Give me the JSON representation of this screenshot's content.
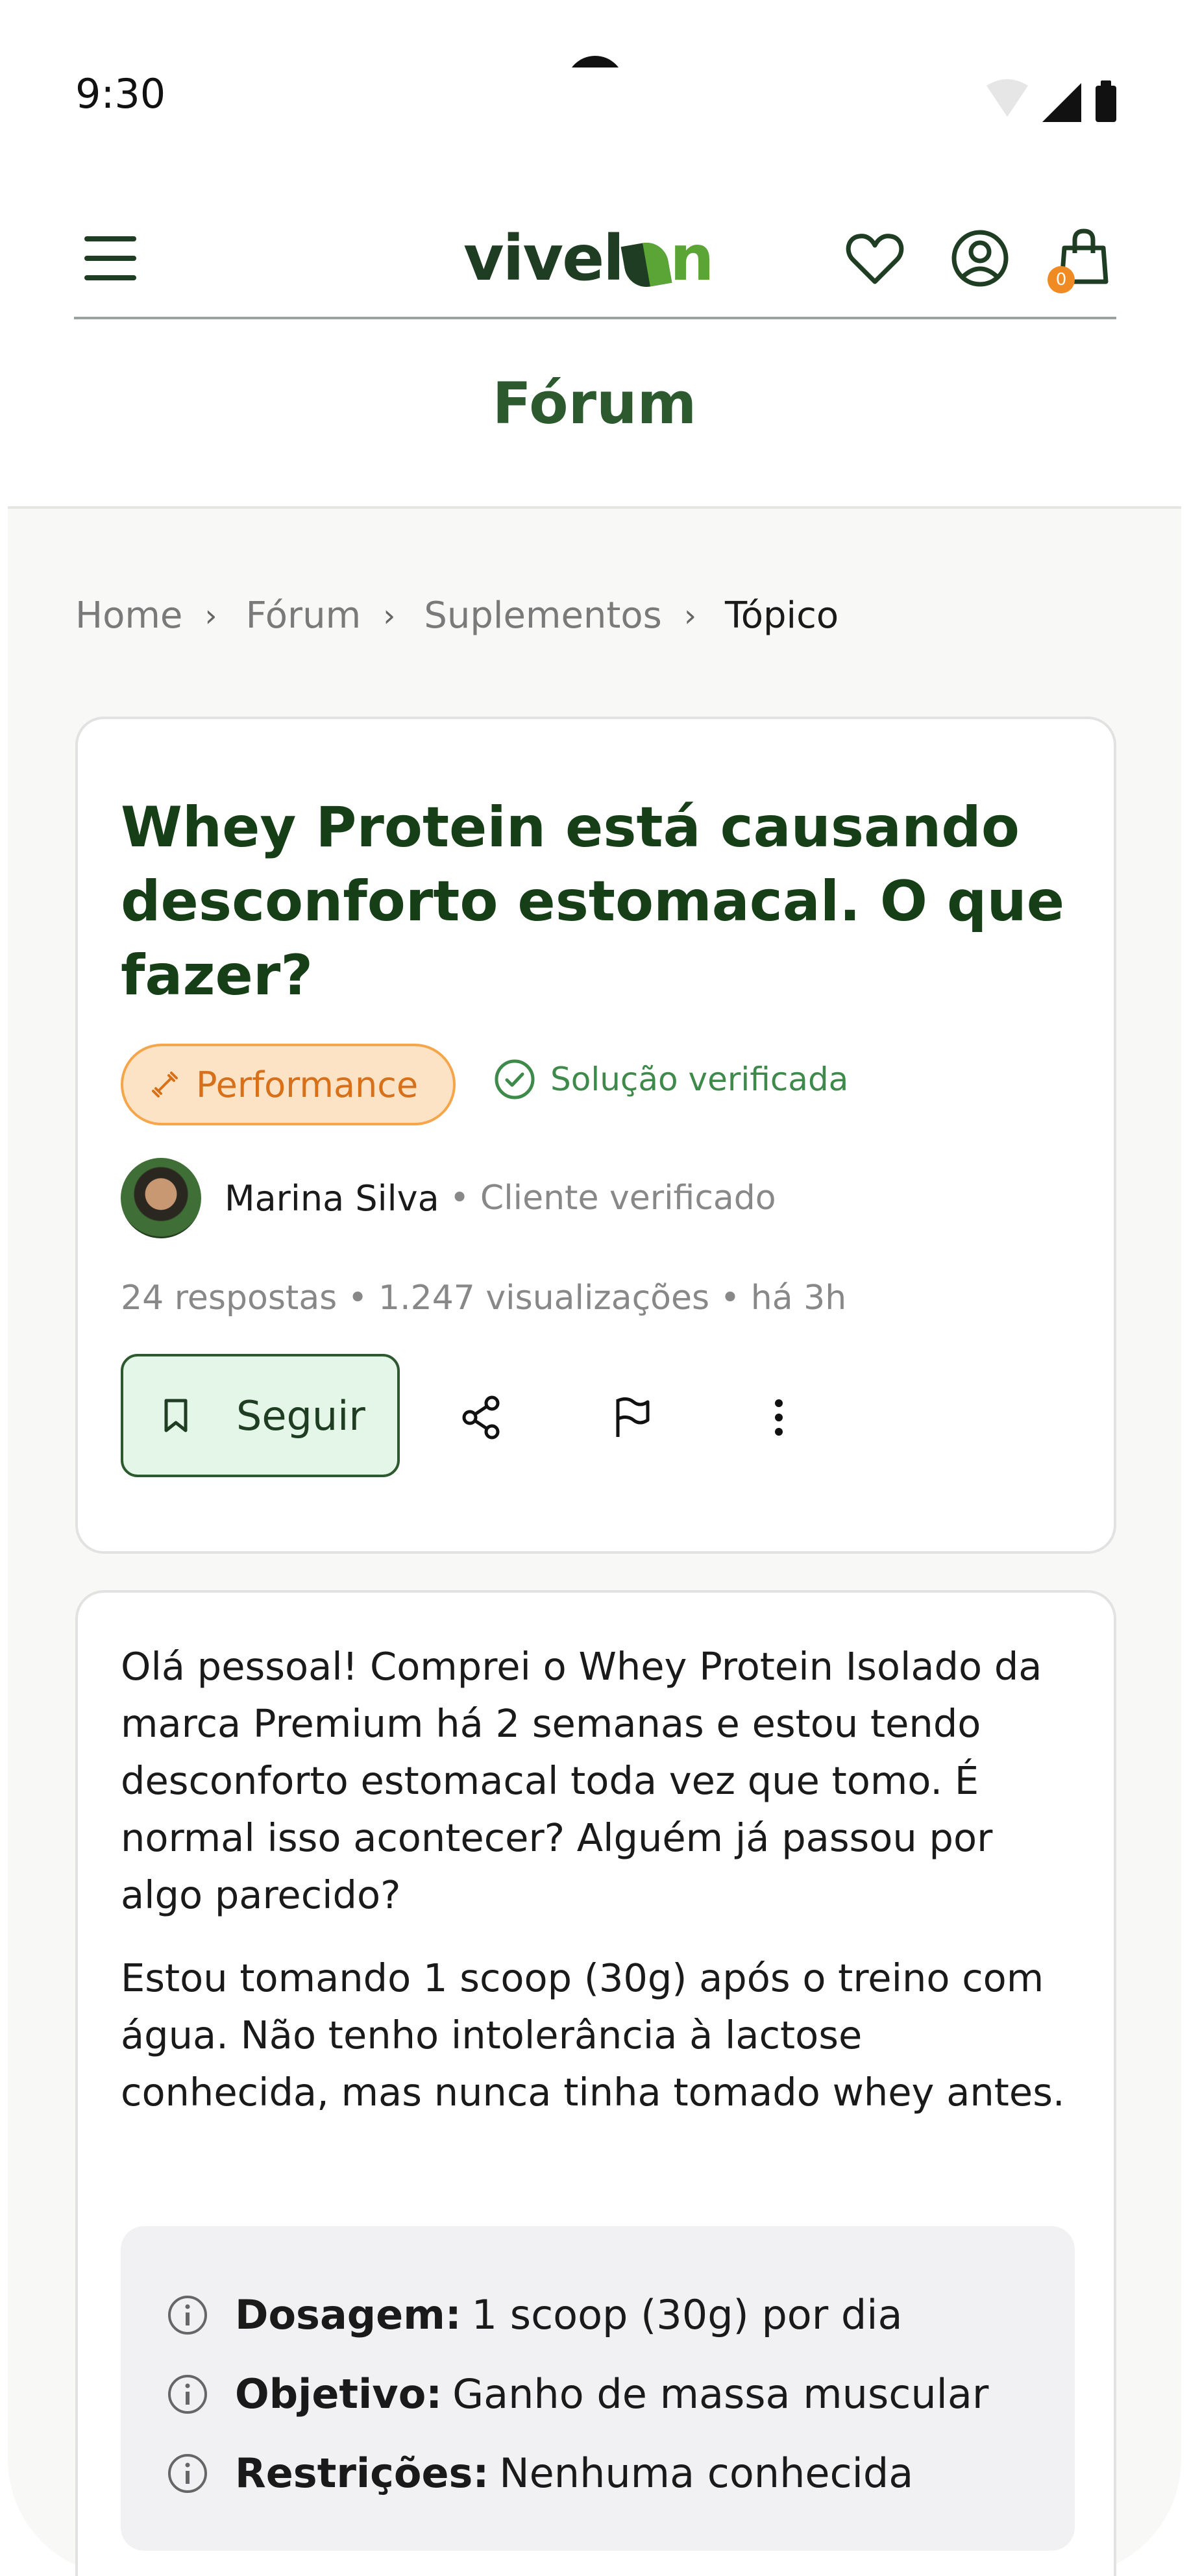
{
  "status_bar": {
    "time": "9:30"
  },
  "header": {
    "logo": {
      "part1": "vivel",
      "part2": "n"
    },
    "cart_count": "0"
  },
  "page": {
    "title": "Fórum"
  },
  "breadcrumb": [
    "Home",
    "Fórum",
    "Suplementos",
    "Tópico"
  ],
  "topic": {
    "title": "Whey Protein está causando desconforto estomacal. O que fazer?",
    "tag": "Performance",
    "verified_label": "Solução verificada",
    "author": {
      "name": "Marina Silva",
      "role": "• Cliente verificado"
    },
    "stats": "24 respostas • 1.247 visualizações • há 3h",
    "follow_label": "Seguir"
  },
  "post": {
    "paragraph1": "Olá pessoal! Comprei o Whey Protein Isolado da marca Premium há 2 semanas e estou tendo desconforto estomacal toda vez que tomo. É normal isso acontecer? Alguém já passou por algo parecido?",
    "paragraph2": "Estou tomando 1 scoop (30g) após o treino com água. Não tenho intolerância à lactose conhecida, mas nunca tinha tomado whey antes.",
    "details": [
      {
        "label": "Dosagem:",
        "value": "1 scoop (30g) por dia"
      },
      {
        "label": "Objetivo:",
        "value": "Ganho de massa muscular"
      },
      {
        "label": "Restrições:",
        "value": "Nenhuma conhecida"
      }
    ]
  },
  "colors": {
    "brand_dark": "#1f3d22",
    "brand_green": "#5aa535",
    "title_green": "#163f17",
    "tag_orange": "#d8701a",
    "verified_green": "#3e8a4a"
  }
}
